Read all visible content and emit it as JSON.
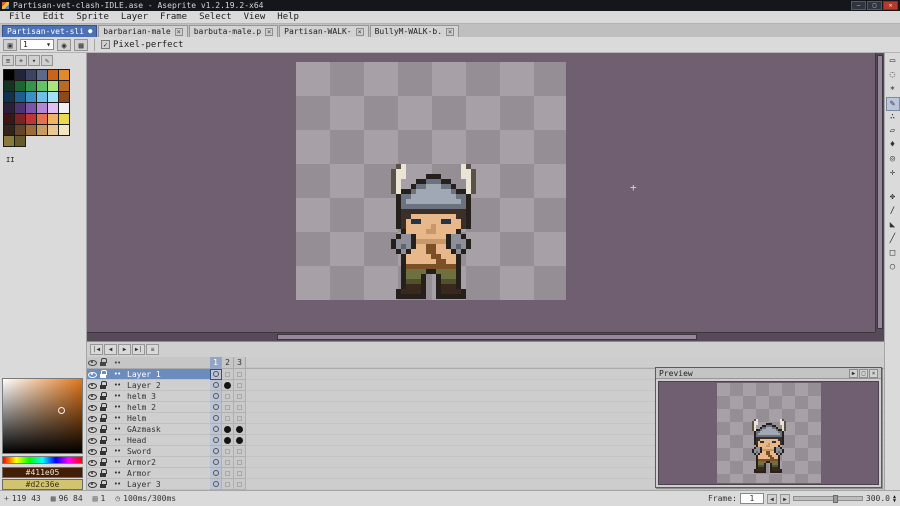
{
  "window": {
    "title": "Partisan-vet-clash-IDLE.ase - Aseprite v1.2.19.2-x64",
    "controls": {
      "minimize": "‒",
      "maximize": "□",
      "close": "✕"
    }
  },
  "menu": {
    "items": [
      "File",
      "Edit",
      "Sprite",
      "Layer",
      "Frame",
      "Select",
      "View",
      "Help"
    ]
  },
  "tabs": [
    {
      "label": "Partisan-vet-sli",
      "indicator": "●",
      "active": true
    },
    {
      "label": "barbarian-male",
      "indicator": "×",
      "active": false
    },
    {
      "label": "barbuta-male.p",
      "indicator": "×",
      "active": false
    },
    {
      "label": "Partisan-WALK-",
      "indicator": "×",
      "active": false
    },
    {
      "label": "BullyM-WALK-b.",
      "indicator": "×",
      "active": false
    }
  ],
  "context_bar": {
    "brush_button": "▣",
    "size_value": "1",
    "size_arrow": "▾",
    "ink_buttons": [
      "◉",
      "▦"
    ],
    "pixel_perfect_icon": "✓",
    "pixel_perfect": "Pixel-perfect"
  },
  "palette_panel": {
    "buttons": [
      "≡",
      "+",
      "▾",
      "✎"
    ],
    "cursor_mark": "II",
    "colors": [
      "#000000",
      "#22253a",
      "#3c4461",
      "#5b6a8c",
      "#c8651b",
      "#e08a2d",
      "#12351f",
      "#1f6331",
      "#35944a",
      "#63c267",
      "#abe37f",
      "#b96a24",
      "#10324e",
      "#205d8f",
      "#3a8fc4",
      "#6fc0e8",
      "#a5e0f5",
      "#8a4a1c",
      "#2a1e3a",
      "#4a3570",
      "#7a55a8",
      "#b288d6",
      "#e0c0ee",
      "#f2f2f2",
      "#3c1515",
      "#7a2424",
      "#bf3636",
      "#e4724f",
      "#f0b467",
      "#ecd94f",
      "#33241a",
      "#62452a",
      "#9a6c3c",
      "#c79a5e",
      "#e9c794",
      "#f4e6c2",
      "#8a7a3c",
      "#665a2c"
    ]
  },
  "color_selector": {
    "foreground": "#411e05",
    "background": "#d2c36e"
  },
  "tools": [
    {
      "name": "rect-marquee",
      "glyph": "▭"
    },
    {
      "name": "lasso",
      "glyph": "◌"
    },
    {
      "name": "magic-wand",
      "glyph": "∗"
    },
    {
      "name": "pencil",
      "glyph": "✎"
    },
    {
      "name": "spray",
      "glyph": "∴"
    },
    {
      "name": "eraser",
      "glyph": "▱"
    },
    {
      "name": "eyedropper",
      "glyph": "♦"
    },
    {
      "name": "zoom",
      "glyph": "◎"
    },
    {
      "name": "hand",
      "glyph": "✛"
    },
    {
      "name": "move",
      "glyph": "✥"
    },
    {
      "name": "slice",
      "glyph": "∕"
    },
    {
      "name": "paint-bucket",
      "glyph": "◣"
    },
    {
      "name": "line",
      "glyph": "╱"
    },
    {
      "name": "rectangle",
      "glyph": "□"
    },
    {
      "name": "ellipse",
      "glyph": "○"
    }
  ],
  "editor": {
    "checker_light": "#a7a1a7",
    "checker_dark": "#958f95",
    "cursor": "+"
  },
  "sprite": {
    "pixel_size": 5,
    "preview_pixel_size": 2,
    "colors": {
      "w": "#5a5248",
      "W": "#e9e4d4",
      "O": "#26201c",
      "h": "#6b7280",
      "H": "#a0a8b4",
      "K": "#3b2f28",
      "S": "#e8b88a",
      "s": "#c8976a",
      "E": "#23344a",
      "A": "#8d9099",
      "a": "#61646c",
      "B": "#7c5026",
      "P": "#6e7040",
      "p": "#50522e",
      "T": "#38291c"
    },
    "rows": [
      "..wW...........Ww..",
      ".wWW...........WWw.",
      ".wWW....OOO....WWw.",
      ".wW...OOhhhOO...Ww.",
      ".wW..OhhHHHhhO..Ww.",
      ".wWOOhHHHHHHHhOOWw.",
      "..OhhHHHHHHHHHhhO..",
      "..OhHHHHHHHHHHHhO..",
      "..OhhhhhhhhhhhhhO..",
      "..OKKKKKKKKKKKKKO..",
      "..OKKSSSSSSSSSKKO..",
      "..OKSEESSSSEESSKO..",
      "..OKSSSSSsSSSSSKO..",
      "...OSSSSssSSSSO....",
      "..OAAOSSSSSSOAAO...",
      ".OAAAOssssssOAAAO..",
      ".OAaAOSSBBSSOAaAO..",
      "..OAOSSSBBSSSOAO...",
      "...OSSSSSBBSSSO....",
      "...OSSSSSSBBSSO....",
      "...OBBBBBBBBBBO....",
      "...OPPPPOOPPPPO....",
      "...OPPPO..OPPPO....",
      "...OpppO..OpppO....",
      "...OTTTO..OTTTO....",
      "..OTTTTO..OTTTTO...",
      "..OOOOOO..OOOOOO..."
    ]
  },
  "timeline": {
    "playback": [
      "|◀",
      "◀",
      "▶",
      "▶|",
      "≡"
    ],
    "frames": [
      "1",
      "2",
      "3"
    ],
    "current_frame_index": 0,
    "continuous_glyph": "••",
    "layers": [
      {
        "name": "Layer 1",
        "selected": true,
        "cels": [
          "outline",
          "blank",
          "blank"
        ]
      },
      {
        "name": "Layer 2",
        "selected": false,
        "cels": [
          "outline",
          "filled",
          "blank"
        ]
      },
      {
        "name": "helm 3",
        "selected": false,
        "cels": [
          "outline",
          "blank",
          "blank"
        ]
      },
      {
        "name": "helm 2",
        "selected": false,
        "cels": [
          "outline",
          "blank",
          "blank"
        ]
      },
      {
        "name": "Helm",
        "selected": false,
        "cels": [
          "outline",
          "blank",
          "blank"
        ]
      },
      {
        "name": "GAzmask",
        "selected": false,
        "cels": [
          "outline",
          "filled",
          "filled"
        ]
      },
      {
        "name": "Head",
        "selected": false,
        "cels": [
          "outline",
          "filled",
          "filled"
        ]
      },
      {
        "name": "Sword",
        "selected": false,
        "cels": [
          "outline",
          "blank",
          "blank"
        ]
      },
      {
        "name": "Armor2",
        "selected": false,
        "cels": [
          "outline",
          "blank",
          "blank"
        ]
      },
      {
        "name": "Armor",
        "selected": false,
        "cels": [
          "outline",
          "blank",
          "blank"
        ]
      },
      {
        "name": "Layer 3",
        "selected": false,
        "cels": [
          "outline",
          "blank",
          "blank"
        ]
      }
    ]
  },
  "preview": {
    "title": "Preview",
    "buttons": [
      "▶",
      "□",
      "×"
    ]
  },
  "status": {
    "position": "119 43",
    "size": "96 84",
    "layer_count": "1",
    "duration": "100ms/300ms",
    "icons": {
      "position": "+",
      "size": "▦",
      "layer": "▤",
      "clock": "◷"
    },
    "frame_label": "Frame:",
    "frame_value": "1",
    "frame_minus": "◀",
    "frame_plus": "▶",
    "zoom_value": "300.0",
    "spin_up": "▲",
    "spin_down": "▼"
  }
}
